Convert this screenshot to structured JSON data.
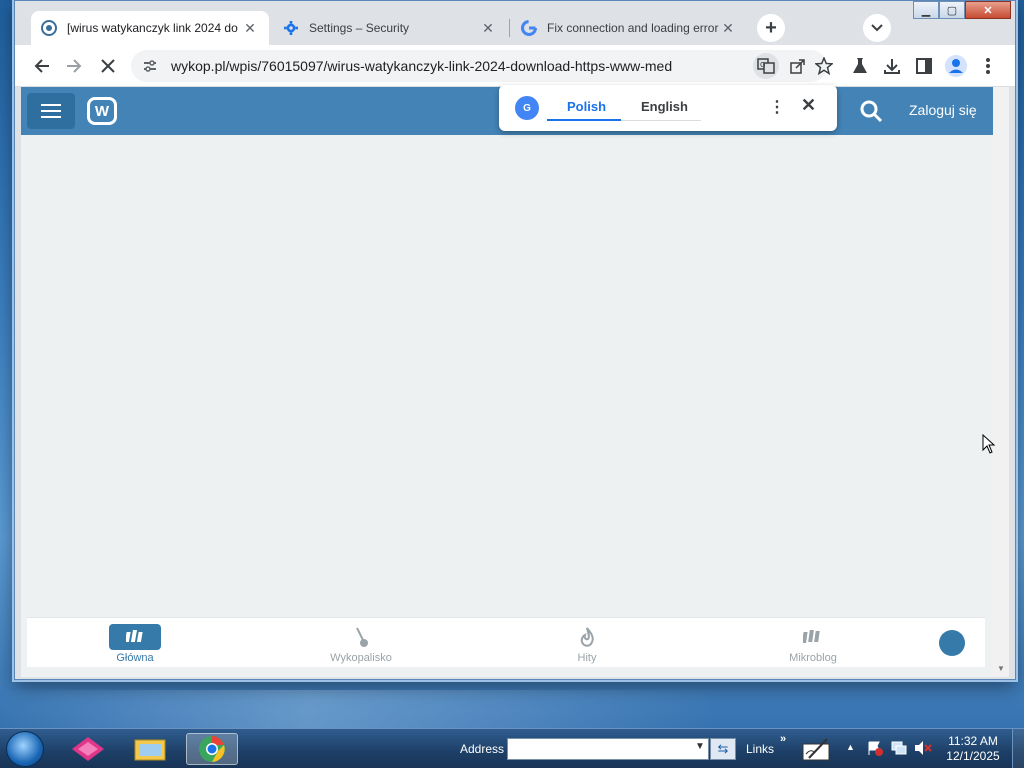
{
  "browser": {
    "tabs": [
      {
        "title": "[wirus watykanczyk link 2024 do",
        "icon": "wykop-favicon-icon",
        "active": true
      },
      {
        "title": "Settings – Security",
        "icon": "gear-icon",
        "active": false
      },
      {
        "title": "Fix connection and loading errors",
        "icon": "google-g-icon",
        "active": false
      }
    ],
    "new_tab_label": "+",
    "url": "wykop.pl/wpis/76015097/wirus-watykanczyk-link-2024-download-https-www-med",
    "window_buttons": {
      "minimize": "▁",
      "maximize": "▢",
      "close": "✕"
    }
  },
  "translate_popup": {
    "languages": [
      "Polish",
      "English"
    ],
    "selected": "Polish"
  },
  "site": {
    "logo_letter": "W",
    "login_label": "Zaloguj się"
  },
  "bottom_nav": {
    "items": [
      {
        "label": "Główna",
        "icon": "wykop-home-icon",
        "active": true
      },
      {
        "label": "Wykopalisko",
        "icon": "shovel-icon",
        "active": false
      },
      {
        "label": "Hity",
        "icon": "flame-icon",
        "active": false
      },
      {
        "label": "Mikroblog",
        "icon": "mikroblog-icon",
        "active": false
      }
    ]
  },
  "taskbar": {
    "address_label": "Address",
    "address_value": "",
    "links_label": "Links",
    "links_chevron": "»",
    "time": "11:32 AM",
    "date": "12/1/2025"
  },
  "colors": {
    "wykop_blue": "#4383b5",
    "wykop_dark": "#367aa9",
    "page_bg": "#edf1f2"
  }
}
